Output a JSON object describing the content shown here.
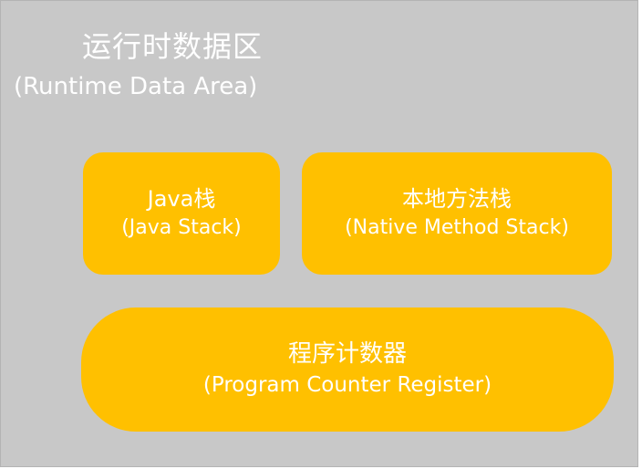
{
  "area": {
    "title_zh": "运行时数据区",
    "title_en": "(Runtime Data Area)"
  },
  "boxes": {
    "java_stack": {
      "title_zh": "Java栈",
      "title_en": "(Java Stack)"
    },
    "native_method_stack": {
      "title_zh": "本地方法栈",
      "title_en": "(Native Method Stack)"
    },
    "program_counter_register": {
      "title_zh": "程序计数器",
      "title_en": "(Program Counter Register)"
    }
  },
  "colors": {
    "area_background": "#c8c8c8",
    "box_fill": "#ffc000",
    "text": "#ffffff"
  }
}
